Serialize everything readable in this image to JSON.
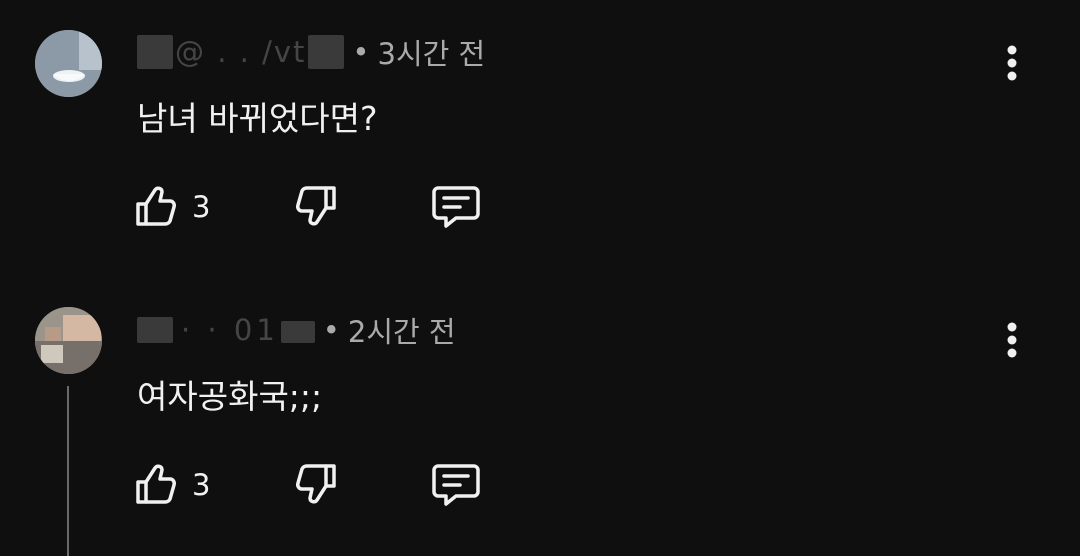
{
  "comments": [
    {
      "handle_visible": "@       .  . /vt",
      "separator": "•",
      "time": "3시간 전",
      "text": "남녀 바뀌었다면?",
      "likes": "3",
      "icons": {
        "like": "thumbs-up-icon",
        "dislike": "thumbs-down-icon",
        "reply": "reply-comment-icon",
        "menu": "more-vertical-icon"
      }
    },
    {
      "handle_visible": "  ·   ·  01",
      "separator": "•",
      "time": "2시간 전",
      "text": "여자공화국;;;",
      "likes": "3",
      "icons": {
        "like": "thumbs-up-icon",
        "dislike": "thumbs-down-icon",
        "reply": "reply-comment-icon",
        "menu": "more-vertical-icon"
      }
    }
  ],
  "colors": {
    "background": "#0f0f0f",
    "text_primary": "#f1f1f1",
    "text_secondary": "#aaaaaa",
    "thread_line": "#6a6a6a"
  }
}
